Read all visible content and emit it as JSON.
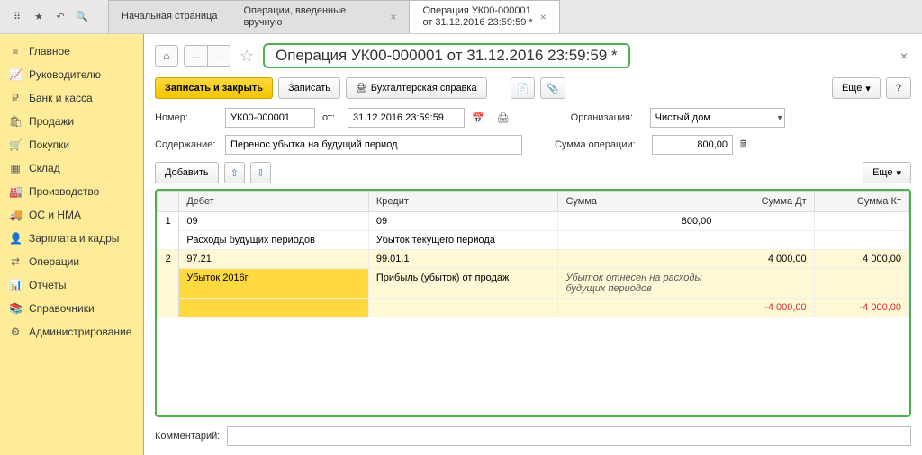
{
  "topbar": {
    "icons": [
      "apps-icon",
      "star-icon",
      "history-icon",
      "search-icon"
    ]
  },
  "tabs": [
    {
      "label": "Начальная страница",
      "closable": false
    },
    {
      "label": "Операции, введенные вручную",
      "closable": true
    },
    {
      "label_line1": "Операция УК00-000001",
      "label_line2": "от 31.12.2016 23:59:59 *",
      "closable": true,
      "active": true
    }
  ],
  "sidebar": {
    "items": [
      {
        "icon": "≡",
        "label": "Главное"
      },
      {
        "icon": "📈",
        "label": "Руководителю"
      },
      {
        "icon": "₽",
        "label": "Банк и касса"
      },
      {
        "icon": "🛍",
        "label": "Продажи"
      },
      {
        "icon": "🛒",
        "label": "Покупки"
      },
      {
        "icon": "▦",
        "label": "Склад"
      },
      {
        "icon": "🏭",
        "label": "Производство"
      },
      {
        "icon": "🚚",
        "label": "ОС и НМА"
      },
      {
        "icon": "👤",
        "label": "Зарплата и кадры"
      },
      {
        "icon": "⇄",
        "label": "Операции"
      },
      {
        "icon": "📊",
        "label": "Отчеты"
      },
      {
        "icon": "📚",
        "label": "Справочники"
      },
      {
        "icon": "⚙",
        "label": "Администрирование"
      }
    ]
  },
  "page": {
    "title": "Операция УК00-000001 от 31.12.2016 23:59:59 *"
  },
  "toolbar": {
    "save_close": "Записать и закрыть",
    "save": "Записать",
    "accounting_ref": "Бухгалтерская справка",
    "more": "Еще",
    "help": "?"
  },
  "form": {
    "number_label": "Номер:",
    "number_value": "УК00-000001",
    "from_label": "от:",
    "date_value": "31.12.2016 23:59:59",
    "org_label": "Организация:",
    "org_value": "Чистый дом",
    "content_label": "Содержание:",
    "content_value": "Перенос убытка на будущий период",
    "sum_label": "Сумма операции:",
    "sum_value": "800,00"
  },
  "subtoolbar": {
    "add": "Добавить",
    "more": "Еще"
  },
  "grid": {
    "headers": [
      "",
      "Дебет",
      "Кредит",
      "Сумма",
      "Сумма Дт",
      "Сумма Кт"
    ],
    "rows": [
      {
        "n": "1",
        "debit_code": "09",
        "debit_desc": "Расходы будущих периодов",
        "credit_code": "09",
        "credit_desc": "Убыток текущего периода",
        "sum": "800,00",
        "sum_dt": "",
        "sum_kt": ""
      },
      {
        "n": "2",
        "debit_code": "97.21",
        "debit_desc": "Убыток 2016г",
        "credit_code": "99.01.1",
        "credit_desc": "Прибыль (убыток) от продаж",
        "sum_desc": "Убыток отнесен на расходы будущих периодов",
        "sum_dt": "4 000,00",
        "sum_kt": "4 000,00",
        "sum_dt_neg": "-4 000,00",
        "sum_kt_neg": "-4 000,00",
        "highlight": true
      }
    ]
  },
  "comment": {
    "label": "Комментарий:",
    "value": ""
  }
}
